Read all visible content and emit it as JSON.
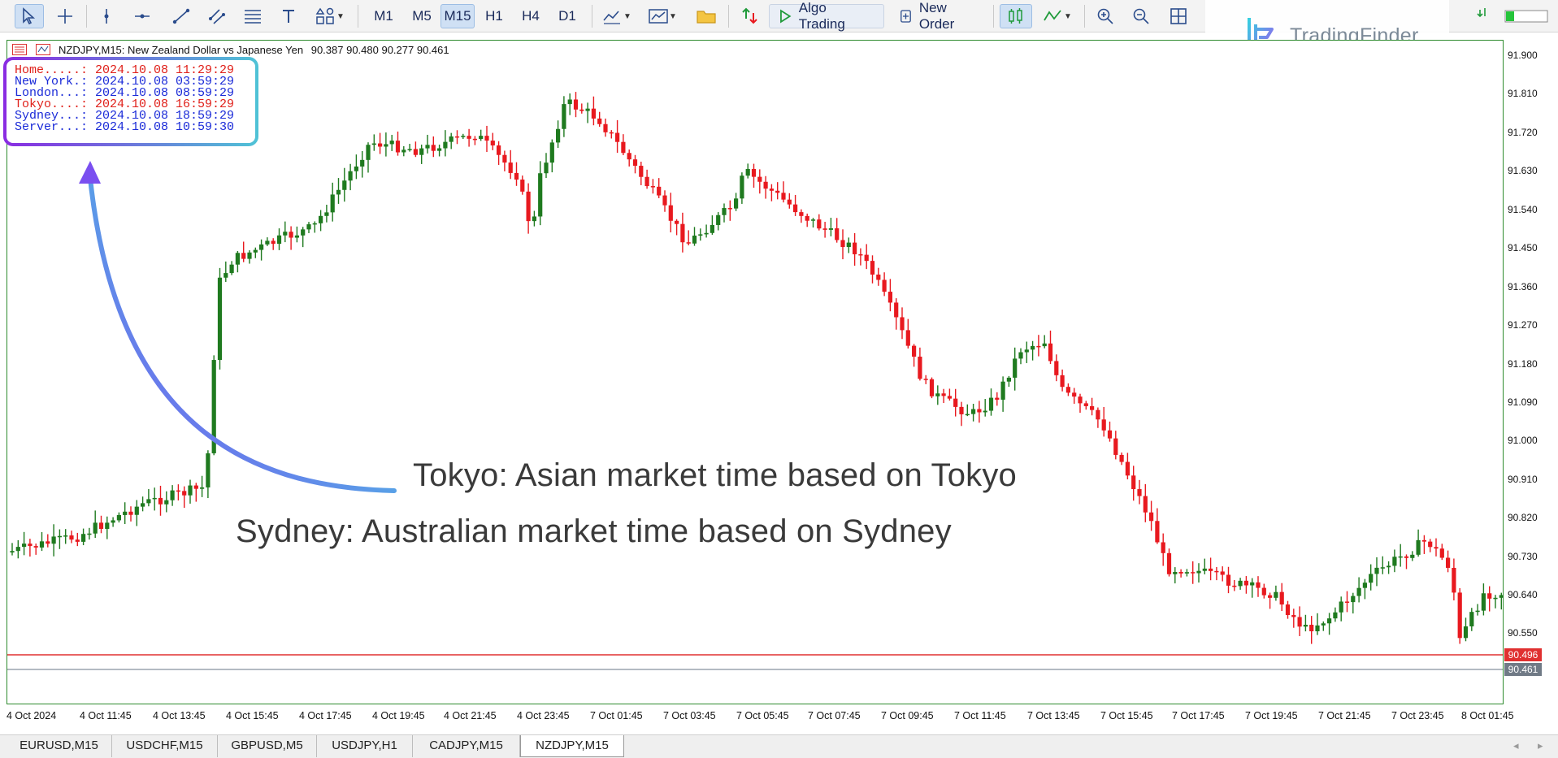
{
  "toolbar": {
    "timeframes": [
      "M1",
      "M5",
      "M15",
      "H1",
      "H4",
      "D1"
    ],
    "active_timeframe": "M15",
    "algo_trading_label": "Algo Trading",
    "new_order_label": "New Order"
  },
  "logo": {
    "text": "TradingFinder"
  },
  "chart": {
    "title": "NZDJPY,M15:  New Zealand Dollar vs Japanese Yen",
    "ohlc": "90.387 90.480 90.277 90.461",
    "clocks": [
      {
        "label": "Home.....:",
        "value": "2024.10.08 11:29:29",
        "color": "#e0201a"
      },
      {
        "label": "New York.:",
        "value": "2024.10.08 03:59:29",
        "color": "#1a2ad8"
      },
      {
        "label": "London...:",
        "value": "2024.10.08 08:59:29",
        "color": "#1a2ad8"
      },
      {
        "label": "Tokyo....:",
        "value": "2024.10.08 16:59:29",
        "color": "#e0201a"
      },
      {
        "label": "Sydney...:",
        "value": "2024.10.08 18:59:29",
        "color": "#1a2ad8"
      },
      {
        "label": "Server...:",
        "value": "2024.10.08 10:59:30",
        "color": "#1a2ad8"
      }
    ],
    "price_labels": [
      "91.900",
      "91.810",
      "91.720",
      "91.630",
      "91.540",
      "91.450",
      "91.360",
      "91.270",
      "91.180",
      "91.090",
      "91.000",
      "90.910",
      "90.820",
      "90.730",
      "90.640",
      "90.550"
    ],
    "bid_line": {
      "value": "90.496",
      "color": "#e03030"
    },
    "current_price": {
      "value": "90.461",
      "color": "#707a86"
    },
    "time_labels": [
      "4 Oct 2024",
      "4 Oct 11:45",
      "4 Oct 13:45",
      "4 Oct 15:45",
      "4 Oct 17:45",
      "4 Oct 19:45",
      "4 Oct 21:45",
      "4 Oct 23:45",
      "7 Oct 01:45",
      "7 Oct 03:45",
      "7 Oct 05:45",
      "7 Oct 07:45",
      "7 Oct 09:45",
      "7 Oct 11:45",
      "7 Oct 13:45",
      "7 Oct 15:45",
      "7 Oct 17:45",
      "7 Oct 19:45",
      "7 Oct 21:45",
      "7 Oct 23:45",
      "8 Oct 01:45"
    ],
    "colors": {
      "bull": "#1f7a1f",
      "bear": "#e8191f",
      "axis": "#2e8b2e"
    }
  },
  "annotations": {
    "tokyo": "Tokyo: Asian market time based on Tokyo",
    "sydney": "Sydney: Australian market time based on Sydney"
  },
  "tabs": [
    "EURUSD,M15",
    "USDCHF,M15",
    "GBPUSD,M5",
    "USDJPY,H1",
    "CADJPY,M15",
    "NZDJPY,M15"
  ],
  "active_tab": "NZDJPY,M15"
}
